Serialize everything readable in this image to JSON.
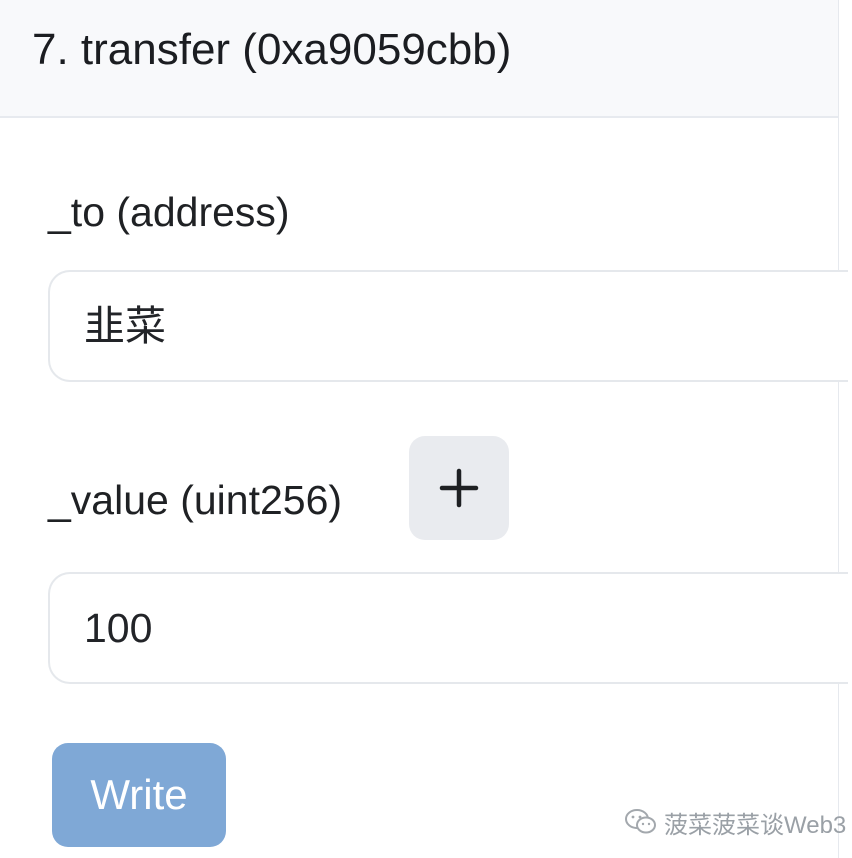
{
  "function_card": {
    "title": "7. transfer (0xa9059cbb)"
  },
  "fields": {
    "to": {
      "label": "_to (address)",
      "value": "韭菜"
    },
    "value": {
      "label": "_value (uint256)",
      "add_button_icon": "plus-icon",
      "value": "100"
    }
  },
  "actions": {
    "write_label": "Write"
  },
  "watermark": {
    "icon": "wechat-icon",
    "text": "菠菜菠菜谈Web3"
  },
  "colors": {
    "header_bg": "#f8f9fb",
    "write_button_bg": "#7fa8d6",
    "add_button_bg": "#e9ebef"
  }
}
